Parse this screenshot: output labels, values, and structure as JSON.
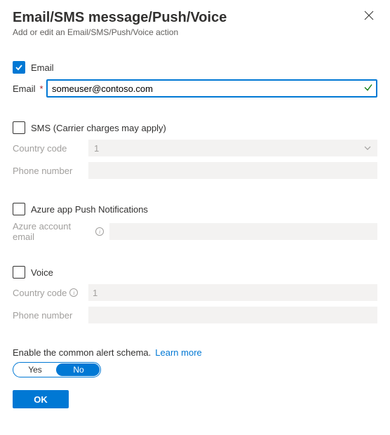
{
  "header": {
    "title": "Email/SMS message/Push/Voice",
    "subtitle": "Add or edit an Email/SMS/Push/Voice action"
  },
  "email": {
    "checkbox_label": "Email",
    "checked": true,
    "field_label": "Email",
    "value": "someuser@contoso.com"
  },
  "sms": {
    "checkbox_label": "SMS (Carrier charges may apply)",
    "country_code_label": "Country code",
    "country_code_value": "1",
    "phone_label": "Phone number",
    "phone_value": ""
  },
  "push": {
    "checkbox_label": "Azure app Push Notifications",
    "account_label": "Azure account email",
    "account_value": ""
  },
  "voice": {
    "checkbox_label": "Voice",
    "country_code_label": "Country code",
    "country_code_value": "1",
    "phone_label": "Phone number",
    "phone_value": ""
  },
  "schema": {
    "text": "Enable the common alert schema.",
    "link": "Learn more",
    "yes": "Yes",
    "no": "No"
  },
  "actions": {
    "ok": "OK"
  }
}
